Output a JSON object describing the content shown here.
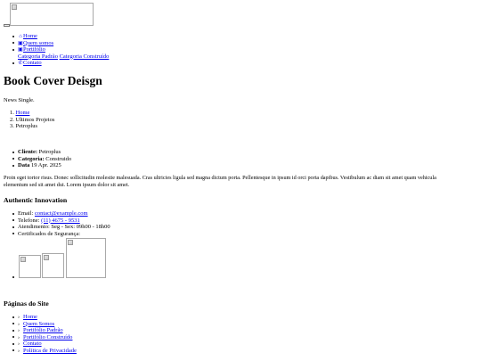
{
  "header": {
    "logo_alt": "",
    "nav": [
      {
        "icon": "home-icon",
        "label": "Home"
      },
      {
        "icon": "building-icon",
        "label": "Quem somos"
      },
      {
        "icon": "briefcase-icon",
        "label": "Portifólio",
        "subitems": [
          "Categoria Padrão",
          "Categoria Construído"
        ]
      },
      {
        "icon": "phone-icon",
        "label": "Contato"
      }
    ]
  },
  "page": {
    "title": "Book Cover Deisgn",
    "subtitle": "News Single.",
    "breadcrumb": [
      "Home",
      "Ultimos Projetos",
      "Petroplus"
    ]
  },
  "project": {
    "meta": [
      {
        "label": "Cliente:",
        "value": "Petroplus"
      },
      {
        "label": "Categoria:",
        "value": "Construido"
      },
      {
        "label": "Data",
        "value": "19 Apr. 2025"
      }
    ],
    "description_line1": "Proin eget tortor risus. Donec sollicitudin molestie malesuada. Cras ultricies ligula sed magna dictum porta. Pellentesque in ipsum id orci porta dapibus. Vestibulum ac diam sit amet quam vehicula",
    "description_line2": "elementum sed sit amet dui. Lorem ipsum dolor sit amet."
  },
  "footer": {
    "company_heading": "Authentic Innovation",
    "email_label": "Email:",
    "email": "contact@example.com",
    "phone_label": "Telefone:",
    "phone": "(11) 4675 - 9531",
    "hours": "Atendimento: Seg - Sex: 09h00 - 18h00",
    "certificates_label": "Certificados de Segurança:",
    "pages_heading": "Páginas do Site",
    "pages": [
      "Home",
      "Quem Somos",
      "Portifólio Padrão",
      "Portifólio Construído",
      "Contato",
      "Política de Privacidade"
    ]
  }
}
